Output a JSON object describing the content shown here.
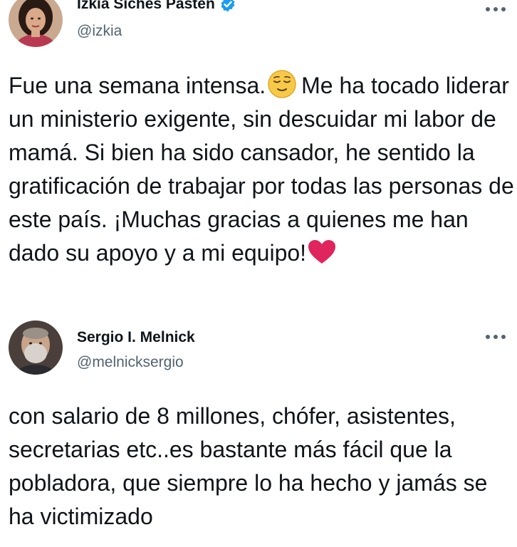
{
  "tweet_1": {
    "display_name": "Izkia Siches Pastén",
    "handle": "@izkia",
    "verified": true,
    "text_line_1": "Fue una semana intensa.",
    "emoji_1": "relieved-face-emoji",
    "text_line_1_cont": "Me ha",
    "text_rest": "tocado liderar un ministerio exigente, sin descuidar mi labor de mamá. Si bien ha sido cansador, he sentido la gratificación de trabajar por todas las personas de este país. ¡Muchas gracias a quienes me han dado su apoyo y a mi equipo!",
    "emoji_2": "red-heart-emoji"
  },
  "tweet_2": {
    "display_name": "Sergio I. Melnick",
    "handle": "@melnicksergio",
    "verified": false,
    "text": "con salario de 8 millones, chófer, asistentes, secretarias etc..es bastante más fácil que la pobladora, que siempre lo ha hecho y jamás se ha victimizado"
  },
  "colors": {
    "text_primary": "#0f1419",
    "text_secondary": "#536471",
    "verified_blue": "#1d9bf0",
    "heart_red": "#e0245e",
    "emoji_yellow": "#f7c948"
  }
}
